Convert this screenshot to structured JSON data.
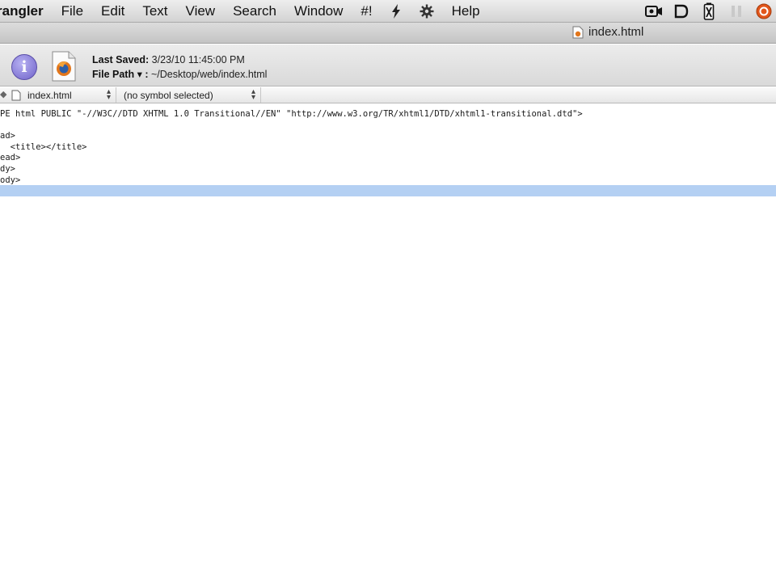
{
  "menubar": {
    "app_name": "rangler",
    "items": [
      "File",
      "Edit",
      "Text",
      "View",
      "Search",
      "Window"
    ],
    "icon_items": [
      {
        "name": "hashbang-menu",
        "glyph": "#!"
      },
      {
        "name": "script-menu",
        "glyph": "§"
      },
      {
        "name": "gear-menu",
        "glyph": "⚙"
      }
    ],
    "help": "Help"
  },
  "window": {
    "title": "index.html"
  },
  "info": {
    "last_saved_label": "Last Saved:",
    "last_saved_value": "3/23/10 11:45:00 PM",
    "file_path_label": "File Path ▾ :",
    "file_path_value": "~/Desktop/web/index.html"
  },
  "navbar": {
    "prefix": "◆",
    "file": "index.html",
    "symbol": "(no symbol selected)"
  },
  "editor": {
    "lines": [
      "PE html PUBLIC \"-//W3C//DTD XHTML 1.0 Transitional//EN\" \"http://www.w3.org/TR/xhtml1/DTD/xhtml1-transitional.dtd\">",
      "",
      "ad>",
      "  <title></title>",
      "ead>",
      "dy>",
      "ody>"
    ],
    "current_line": 6
  },
  "colors": {
    "current_line_highlight": "#b4d0f3",
    "info_button": "#6f62c9",
    "firefox_orange": "#e2761b"
  }
}
